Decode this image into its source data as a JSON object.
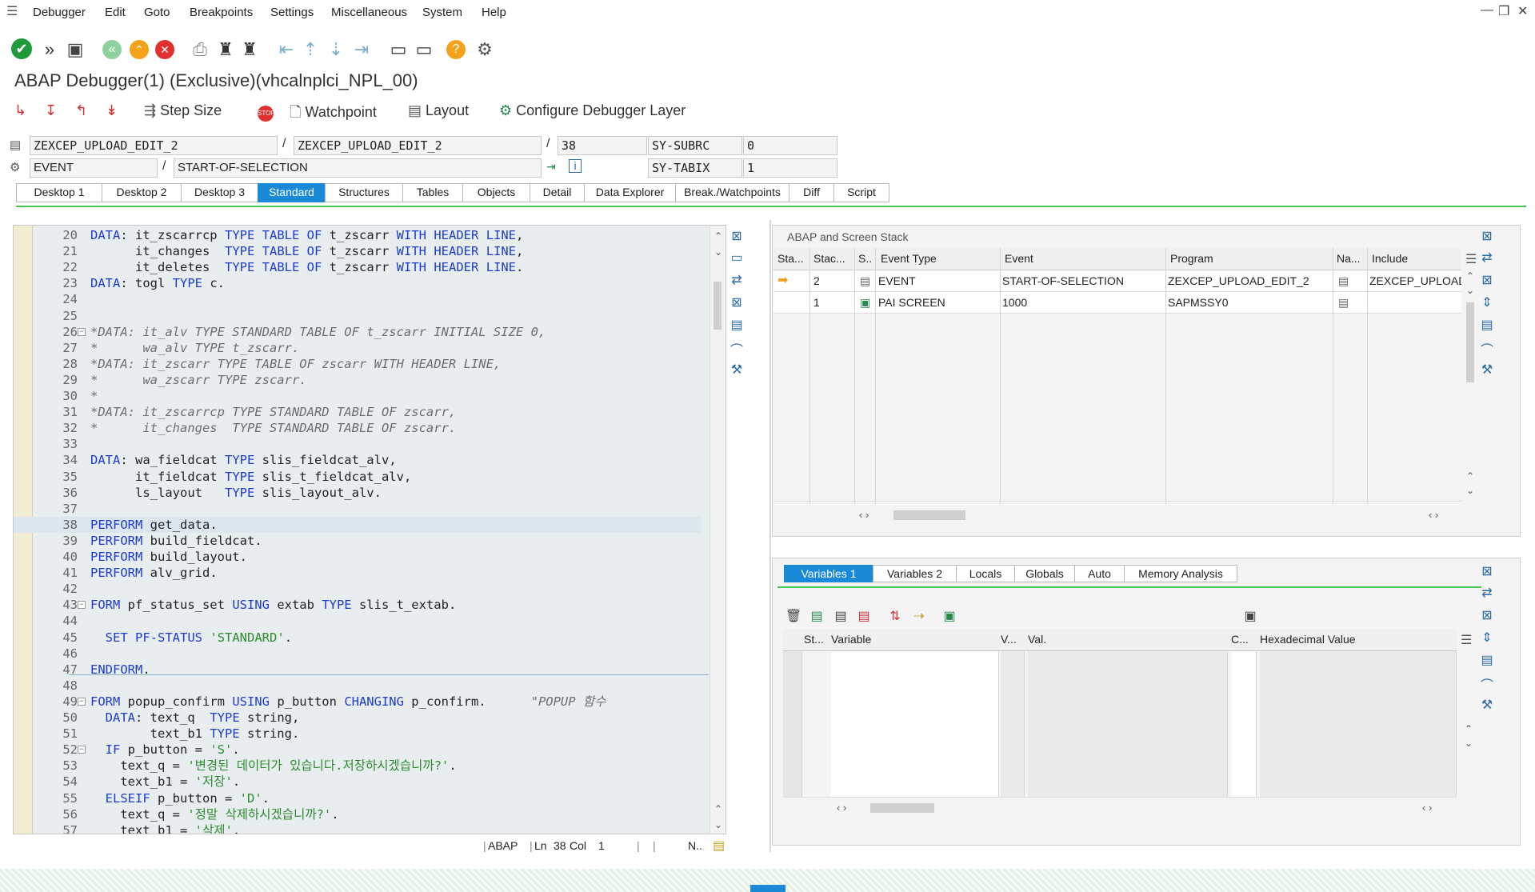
{
  "menu": {
    "items": [
      "Debugger",
      "Edit",
      "Goto",
      "Breakpoints",
      "Settings",
      "Miscellaneous",
      "System",
      "Help"
    ]
  },
  "colors": {
    "accent": "#1a8ad8",
    "green": "#47c24c",
    "keyword": "#1d3bd1",
    "comment": "#6d6d6d",
    "string": "#2d8b2d"
  },
  "toolbar": {
    "icons": [
      "check-icon",
      "fast-forward-icon",
      "save-icon",
      "back-icon",
      "exit-icon",
      "cancel-icon",
      "print-icon",
      "find-icon",
      "find-next-icon",
      "first-page-icon",
      "prev-page-icon",
      "next-page-icon",
      "last-page-icon",
      "new-session-icon",
      "shortcut-icon",
      "help-icon",
      "customize-icon"
    ]
  },
  "window_title": "ABAP Debugger(1)  (Exclusive)(vhcalnplci_NPL_00)",
  "app_toolbar": {
    "step_size": "Step Size",
    "watchpoint": "Watchpoint",
    "layout": "Layout",
    "configure": "Configure Debugger Layer"
  },
  "fields": {
    "program1": "ZEXCEP_UPLOAD_EDIT_2",
    "program2": "ZEXCEP_UPLOAD_EDIT_2",
    "line": "38",
    "sysubrc_label": "SY-SUBRC",
    "sysubrc_value": "0",
    "event_type": "EVENT",
    "event": "START-OF-SELECTION",
    "sytabix_label": "SY-TABIX",
    "sytabix_value": "1"
  },
  "tabs": [
    "Desktop 1",
    "Desktop 2",
    "Desktop 3",
    "Standard",
    "Structures",
    "Tables",
    "Objects",
    "Detail",
    "Data Explorer",
    "Break./Watchpoints",
    "Diff",
    "Script"
  ],
  "active_tab": "Standard",
  "source": {
    "lines": [
      {
        "n": "20",
        "t": "DATA: it_zscarrcp TYPE TABLE OF t_zscarr WITH HEADER LINE,"
      },
      {
        "n": "21",
        "t": "      it_changes  TYPE TABLE OF t_zscarr WITH HEADER LINE,"
      },
      {
        "n": "22",
        "t": "      it_deletes  TYPE TABLE OF t_zscarr WITH HEADER LINE."
      },
      {
        "n": "23",
        "t": "DATA: togl TYPE c."
      },
      {
        "n": "24",
        "t": ""
      },
      {
        "n": "25",
        "t": ""
      },
      {
        "n": "26",
        "t": "*DATA: it_alv TYPE STANDARD TABLE OF t_zscarr INITIAL SIZE 0,"
      },
      {
        "n": "27",
        "t": "*      wa_alv TYPE t_zscarr."
      },
      {
        "n": "28",
        "t": "*DATA: it_zscarr TYPE TABLE OF zscarr WITH HEADER LINE,"
      },
      {
        "n": "29",
        "t": "*      wa_zscarr TYPE zscarr."
      },
      {
        "n": "30",
        "t": "*"
      },
      {
        "n": "31",
        "t": "*DATA: it_zscarrcp TYPE STANDARD TABLE OF zscarr,"
      },
      {
        "n": "32",
        "t": "*      it_changes  TYPE STANDARD TABLE OF zscarr."
      },
      {
        "n": "33",
        "t": ""
      },
      {
        "n": "34",
        "t": "DATA: wa_fieldcat TYPE slis_fieldcat_alv,"
      },
      {
        "n": "35",
        "t": "      it_fieldcat TYPE slis_t_fieldcat_alv,"
      },
      {
        "n": "36",
        "t": "      ls_layout   TYPE slis_layout_alv."
      },
      {
        "n": "37",
        "t": ""
      },
      {
        "n": "38",
        "t": "PERFORM get_data."
      },
      {
        "n": "39",
        "t": "PERFORM build_fieldcat."
      },
      {
        "n": "40",
        "t": "PERFORM build_layout."
      },
      {
        "n": "41",
        "t": "PERFORM alv_grid."
      },
      {
        "n": "42",
        "t": ""
      },
      {
        "n": "43",
        "t": "FORM pf_status_set USING extab TYPE slis_t_extab."
      },
      {
        "n": "44",
        "t": ""
      },
      {
        "n": "45",
        "t": "  SET PF-STATUS 'STANDARD'."
      },
      {
        "n": "46",
        "t": ""
      },
      {
        "n": "47",
        "t": "ENDFORM."
      },
      {
        "n": "48",
        "t": ""
      },
      {
        "n": "49",
        "t": "FORM popup_confirm USING p_button CHANGING p_confirm.      \"POPUP 함수"
      },
      {
        "n": "50",
        "t": "  DATA: text_q  TYPE string,"
      },
      {
        "n": "51",
        "t": "        text_b1 TYPE string."
      },
      {
        "n": "52",
        "t": "  IF p_button = 'S'."
      },
      {
        "n": "53",
        "t": "    text_q = '변경된 데이터가 있습니다.저장하시겠습니까?'."
      },
      {
        "n": "54",
        "t": "    text_b1 = '저장'."
      },
      {
        "n": "55",
        "t": "  ELSEIF p_button = 'D'."
      },
      {
        "n": "56",
        "t": "    text_q = '정말 삭제하시겠습니까?'."
      },
      {
        "n": "57",
        "t": "    text_b1 = '삭제'."
      }
    ]
  },
  "status_bar": {
    "lang": "ABAP",
    "ln_label": "Ln",
    "ln": "38",
    "col_label": "Col",
    "col": "1",
    "n": "N.."
  },
  "stack": {
    "title": "ABAP and Screen Stack",
    "headers": [
      "Sta...",
      "Stac...",
      "S..",
      "Event Type",
      "Event",
      "Program",
      "Na...",
      "Include"
    ],
    "rows": [
      {
        "level": "2",
        "type": "EVENT",
        "event": "START-OF-SELECTION",
        "program": "ZEXCEP_UPLOAD_EDIT_2",
        "include": "ZEXCEP_UPLOAD"
      },
      {
        "level": "1",
        "type": "PAI SCREEN",
        "event": "1000",
        "program": "SAPMSSY0",
        "include": ""
      }
    ]
  },
  "var_tabs": [
    "Variables 1",
    "Variables 2",
    "Locals",
    "Globals",
    "Auto",
    "Memory Analysis"
  ],
  "var_headers": [
    "St...",
    "Variable",
    "V...",
    "Val.",
    "C...",
    "Hexadecimal Value"
  ]
}
